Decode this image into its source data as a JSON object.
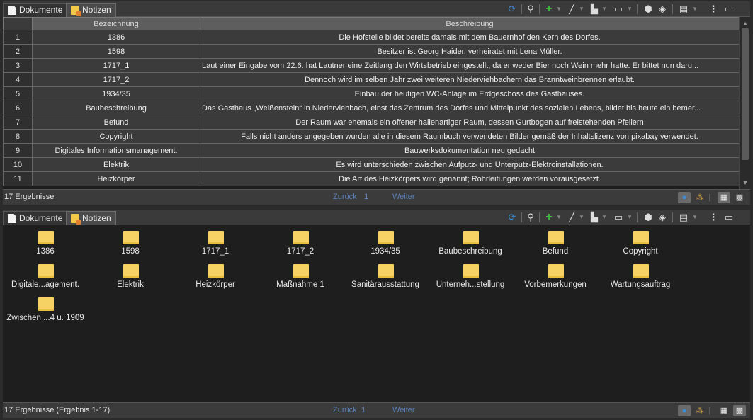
{
  "tabs": {
    "documents": "Dokumente",
    "notes": "Notizen"
  },
  "grid": {
    "columns": [
      "Bezeichnung",
      "Beschreibung"
    ],
    "rows": [
      {
        "n": "1",
        "name": "1386",
        "desc": "Die Hofstelle bildet bereits damals mit dem Bauernhof den Kern des Dorfes."
      },
      {
        "n": "2",
        "name": "1598",
        "desc": "Besitzer ist Georg Haider, verheiratet mit Lena Müller."
      },
      {
        "n": "3",
        "name": "1717_1",
        "desc": "Laut einer Eingabe vom 22.6. hat Lautner eine Zeitlang den Wirtsbetrieb eingestellt, da er weder Bier noch Wein mehr hatte. Er bittet nun daru..."
      },
      {
        "n": "4",
        "name": "1717_2",
        "desc": "Dennoch wird im selben Jahr zwei weiteren Niederviehbachern das Branntweinbrennen erlaubt."
      },
      {
        "n": "5",
        "name": "1934/35",
        "desc": "Einbau der heutigen WC-Anlage im Erdgeschoss des Gasthauses."
      },
      {
        "n": "6",
        "name": "Baubeschreibung",
        "desc": "Das Gasthaus „Weißenstein“ in Niederviehbach, einst das Zentrum des Dorfes und Mittelpunkt des sozialen Lebens, bildet bis heute ein bemer..."
      },
      {
        "n": "7",
        "name": "Befund",
        "desc": "Der Raum war ehemals ein offener hallenartiger Raum, dessen Gurtbogen auf freistehenden Pfeilern"
      },
      {
        "n": "8",
        "name": "Copyright",
        "desc": "Falls nicht anders angegeben wurden alle in diesem Raumbuch verwendeten Bilder gemäß der Inhaltslizenz von pixabay verwendet."
      },
      {
        "n": "9",
        "name": "Digitales Informationsmanagement.",
        "desc": "Bauwerksdokumentation neu gedacht"
      },
      {
        "n": "10",
        "name": "Elektrik",
        "desc": "Es wird unterschieden zwischen Aufputz- und Unterputz-Elektroinstallationen."
      },
      {
        "n": "11",
        "name": "Heizkörper",
        "desc": "Die Art des Heizkörpers wird genannt; Rohrleitungen werden vorausgesetzt."
      }
    ]
  },
  "top_status": {
    "text": "17 Ergebnisse",
    "back": "Zurück",
    "page": "1",
    "next": "Weiter"
  },
  "bottom_status": {
    "text": "17 Ergebnisse (Ergebnis 1-17)",
    "back": "Zurück",
    "page": "1",
    "next": "Weiter"
  },
  "notes": [
    "1386",
    "1598",
    "1717_1",
    "1717_2",
    "1934/35",
    "Baubeschreibung",
    "Befund",
    "Copyright",
    "Digitale...agement.",
    "Elektrik",
    "Heizkörper",
    "Maßnahme 1",
    "Sanitärausstattung",
    "Unterneh...stellung",
    "Vorbemerkungen",
    "Wartungsauftrag",
    "Zwischen ...4 u. 1909"
  ],
  "icons": {
    "toolbar": [
      "refresh-icon",
      "search-icon",
      "add-icon",
      "pen-icon",
      "copy-icon",
      "view-icon",
      "package-icon",
      "tag-icon",
      "clipboard-icon",
      "more-icon",
      "maximize-icon"
    ],
    "accent_refresh": "#3b8fd9",
    "accent_add": "#3fbf3f",
    "note_color": "#f5d263"
  }
}
